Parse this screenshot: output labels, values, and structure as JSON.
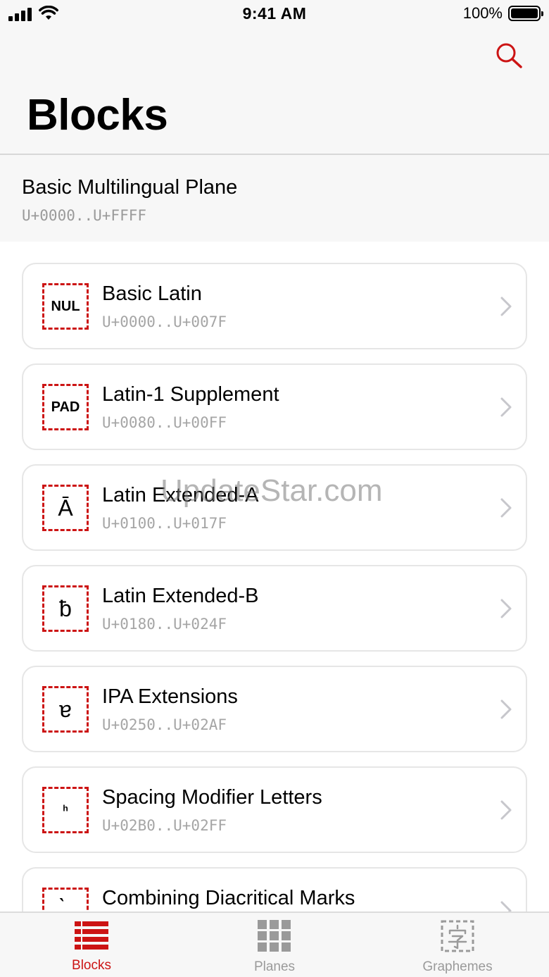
{
  "status_bar": {
    "time": "9:41 AM",
    "battery": "100%"
  },
  "header": {
    "title": "Blocks"
  },
  "plane": {
    "name": "Basic Multilingual Plane",
    "range": "U+0000..U+FFFF"
  },
  "blocks": [
    {
      "glyph": "NUL",
      "name": "Basic Latin",
      "range": "U+0000..U+007F"
    },
    {
      "glyph": "PAD",
      "name": "Latin-1 Supplement",
      "range": "U+0080..U+00FF"
    },
    {
      "glyph": "Ā",
      "name": "Latin Extended-A",
      "range": "U+0100..U+017F"
    },
    {
      "glyph": "ƀ",
      "name": "Latin Extended-B",
      "range": "U+0180..U+024F"
    },
    {
      "glyph": "ɐ",
      "name": "IPA Extensions",
      "range": "U+0250..U+02AF"
    },
    {
      "glyph": "ʰ",
      "name": "Spacing Modifier Letters",
      "range": "U+02B0..U+02FF"
    },
    {
      "glyph": "̀",
      "name": "Combining Diacritical Marks",
      "range": ""
    }
  ],
  "watermark": "UpdateStar.com",
  "tabs": [
    {
      "label": "Blocks",
      "active": true
    },
    {
      "label": "Planes",
      "active": false
    },
    {
      "label": "Graphemes",
      "active": false
    }
  ],
  "colors": {
    "accent": "#cc1414",
    "inactive": "#9a9a9a",
    "background": "#f7f7f7"
  }
}
